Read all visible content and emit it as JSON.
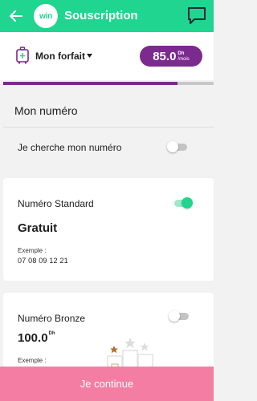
{
  "header": {
    "logo_text": "win",
    "title": "Souscription",
    "icons": {
      "back": "arrow-left-icon",
      "chat": "chat-bubble-icon"
    }
  },
  "plan": {
    "label": "Mon forfait",
    "price": "85.0",
    "currency": "Dh",
    "period": "/mois",
    "icons": {
      "plan": "suitcase-icon",
      "caret": "caret-down-icon"
    }
  },
  "progress": {
    "value": 0.83
  },
  "section": {
    "title": "Mon numéro"
  },
  "search": {
    "label": "Je cherche mon numéro",
    "enabled": false
  },
  "cards": {
    "standard": {
      "name": "Numéro Standard",
      "price": "Gratuit",
      "example_label": "Exemple :",
      "example_number": "07 08 09 12 21",
      "selected": true
    },
    "bronze": {
      "name": "Numéro Bronze",
      "price": "100.0",
      "currency": "Dh",
      "example_label": "Exemple :",
      "selected": false,
      "icon": "podium-icon"
    }
  },
  "footer": {
    "continue_label": "Je continue"
  },
  "colors": {
    "accent_green": "#1fd590",
    "brand_purple": "#7b2a8e",
    "cta_pink": "#f47ea3"
  }
}
